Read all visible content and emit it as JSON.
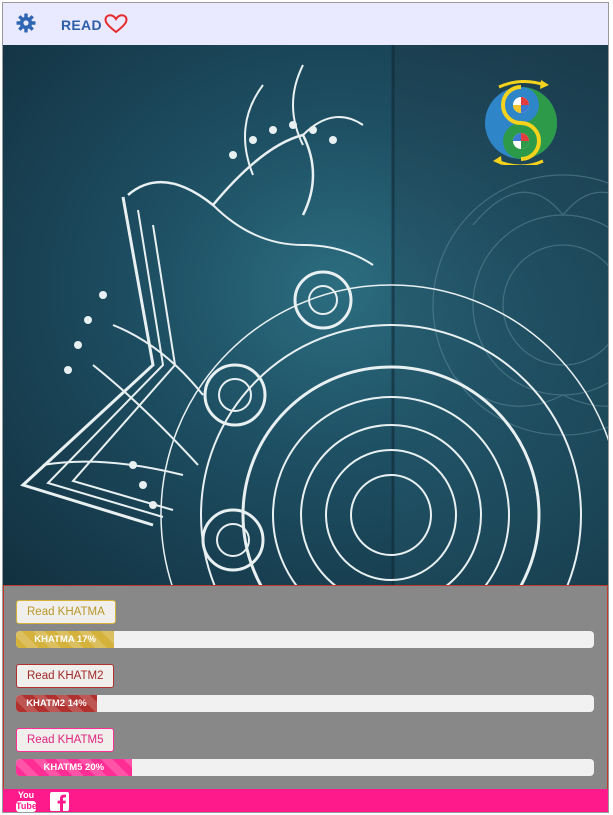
{
  "topbar": {
    "read_label": "READ",
    "icons": [
      "gear-icon",
      "heart-icon"
    ]
  },
  "hero": {
    "logo": "yin-yang-logo"
  },
  "colors": {
    "topbar_bg": "#e9e9ff",
    "panel_bg": "#888888",
    "footer_bg": "#ff1a8c",
    "khatma": "#d4b23c",
    "khatm2": "#b0312e",
    "khatm5": "#ff2e94"
  },
  "khatmas": [
    {
      "button_label": "Read KHATMA",
      "progress_label": "KHATMA 17%",
      "progress": 17
    },
    {
      "button_label": "Read KHATM2",
      "progress_label": "KHATM2 14%",
      "progress": 14
    },
    {
      "button_label": "Read KHATM5",
      "progress_label": "KHATM5 20%",
      "progress": 20
    }
  ],
  "footer": {
    "youtube_top": "You",
    "youtube_bottom": "Tube",
    "facebook_icon": "facebook-icon"
  }
}
